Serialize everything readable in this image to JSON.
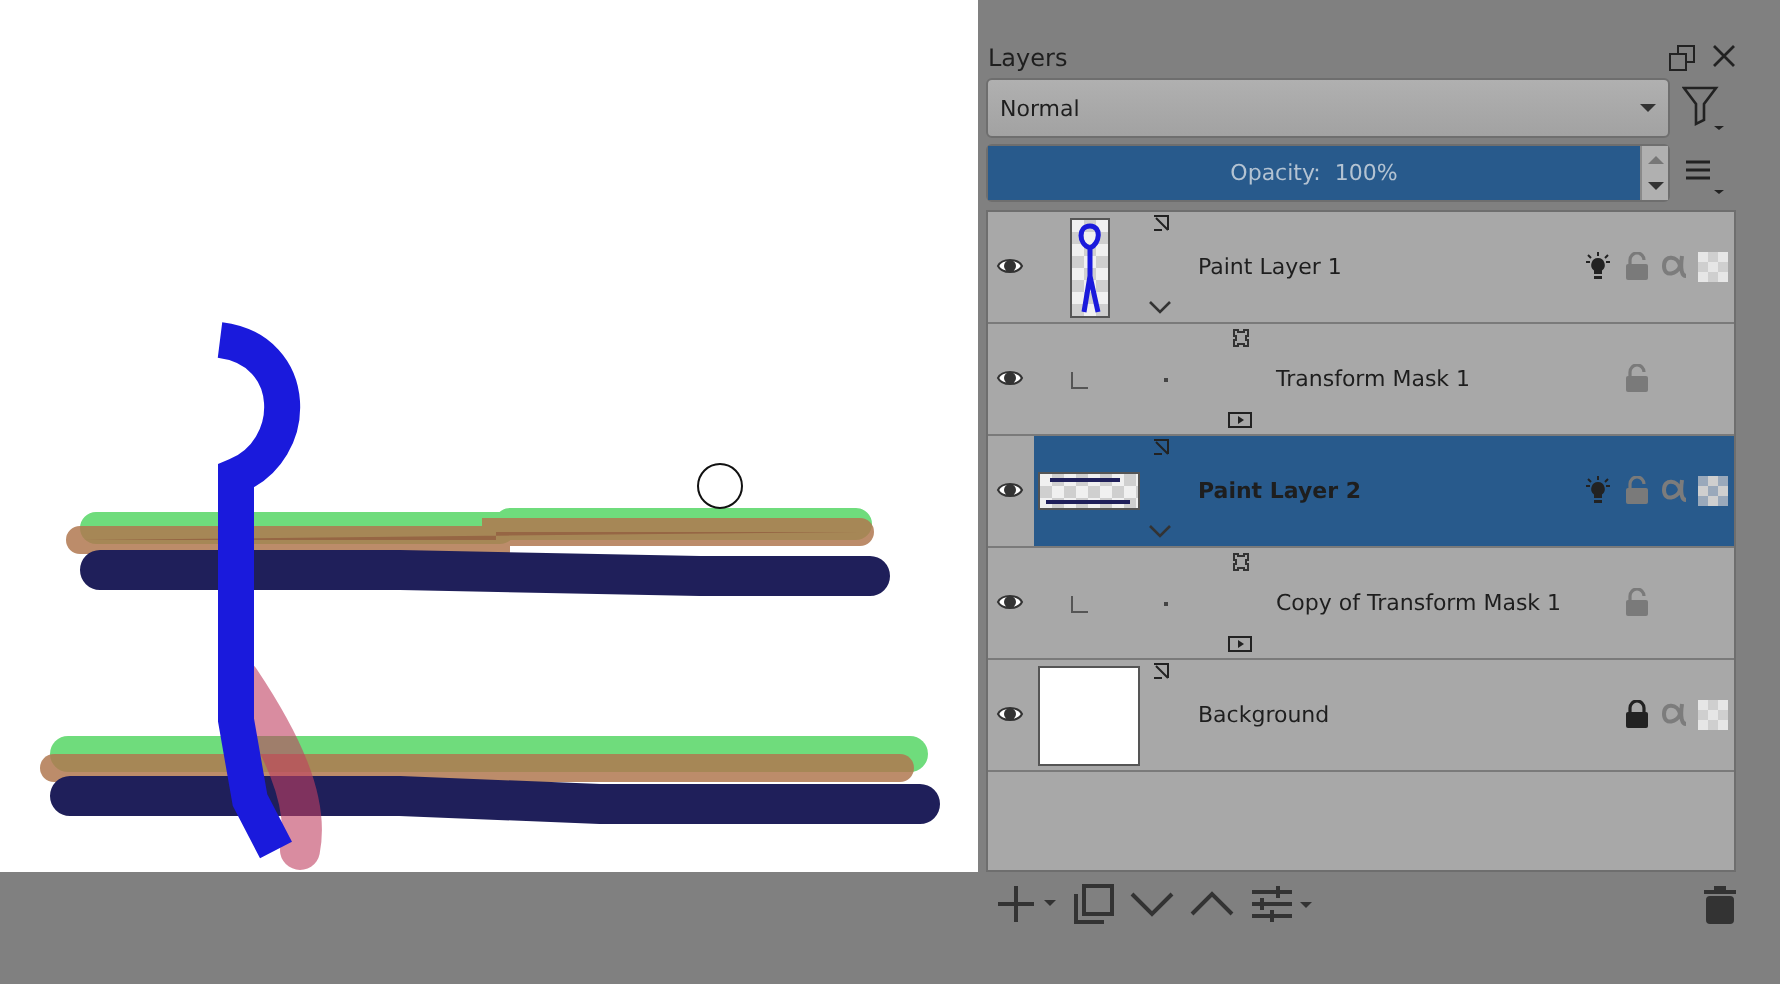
{
  "panel": {
    "title": "Layers"
  },
  "blend_mode": {
    "value": "Normal"
  },
  "opacity": {
    "label": "Opacity:  100%",
    "level": 1
  },
  "layers": [
    {
      "name": "Paint Layer 1",
      "kind": "layer",
      "selected": false,
      "locked": false
    },
    {
      "name": "Transform Mask 1",
      "kind": "mask",
      "selected": false,
      "locked": false
    },
    {
      "name": "Paint Layer 2",
      "kind": "layer",
      "selected": true,
      "locked": false
    },
    {
      "name": "Copy of Transform Mask 1",
      "kind": "mask",
      "selected": false,
      "locked": false
    },
    {
      "name": "Background",
      "kind": "background",
      "selected": false,
      "locked": true
    }
  ]
}
